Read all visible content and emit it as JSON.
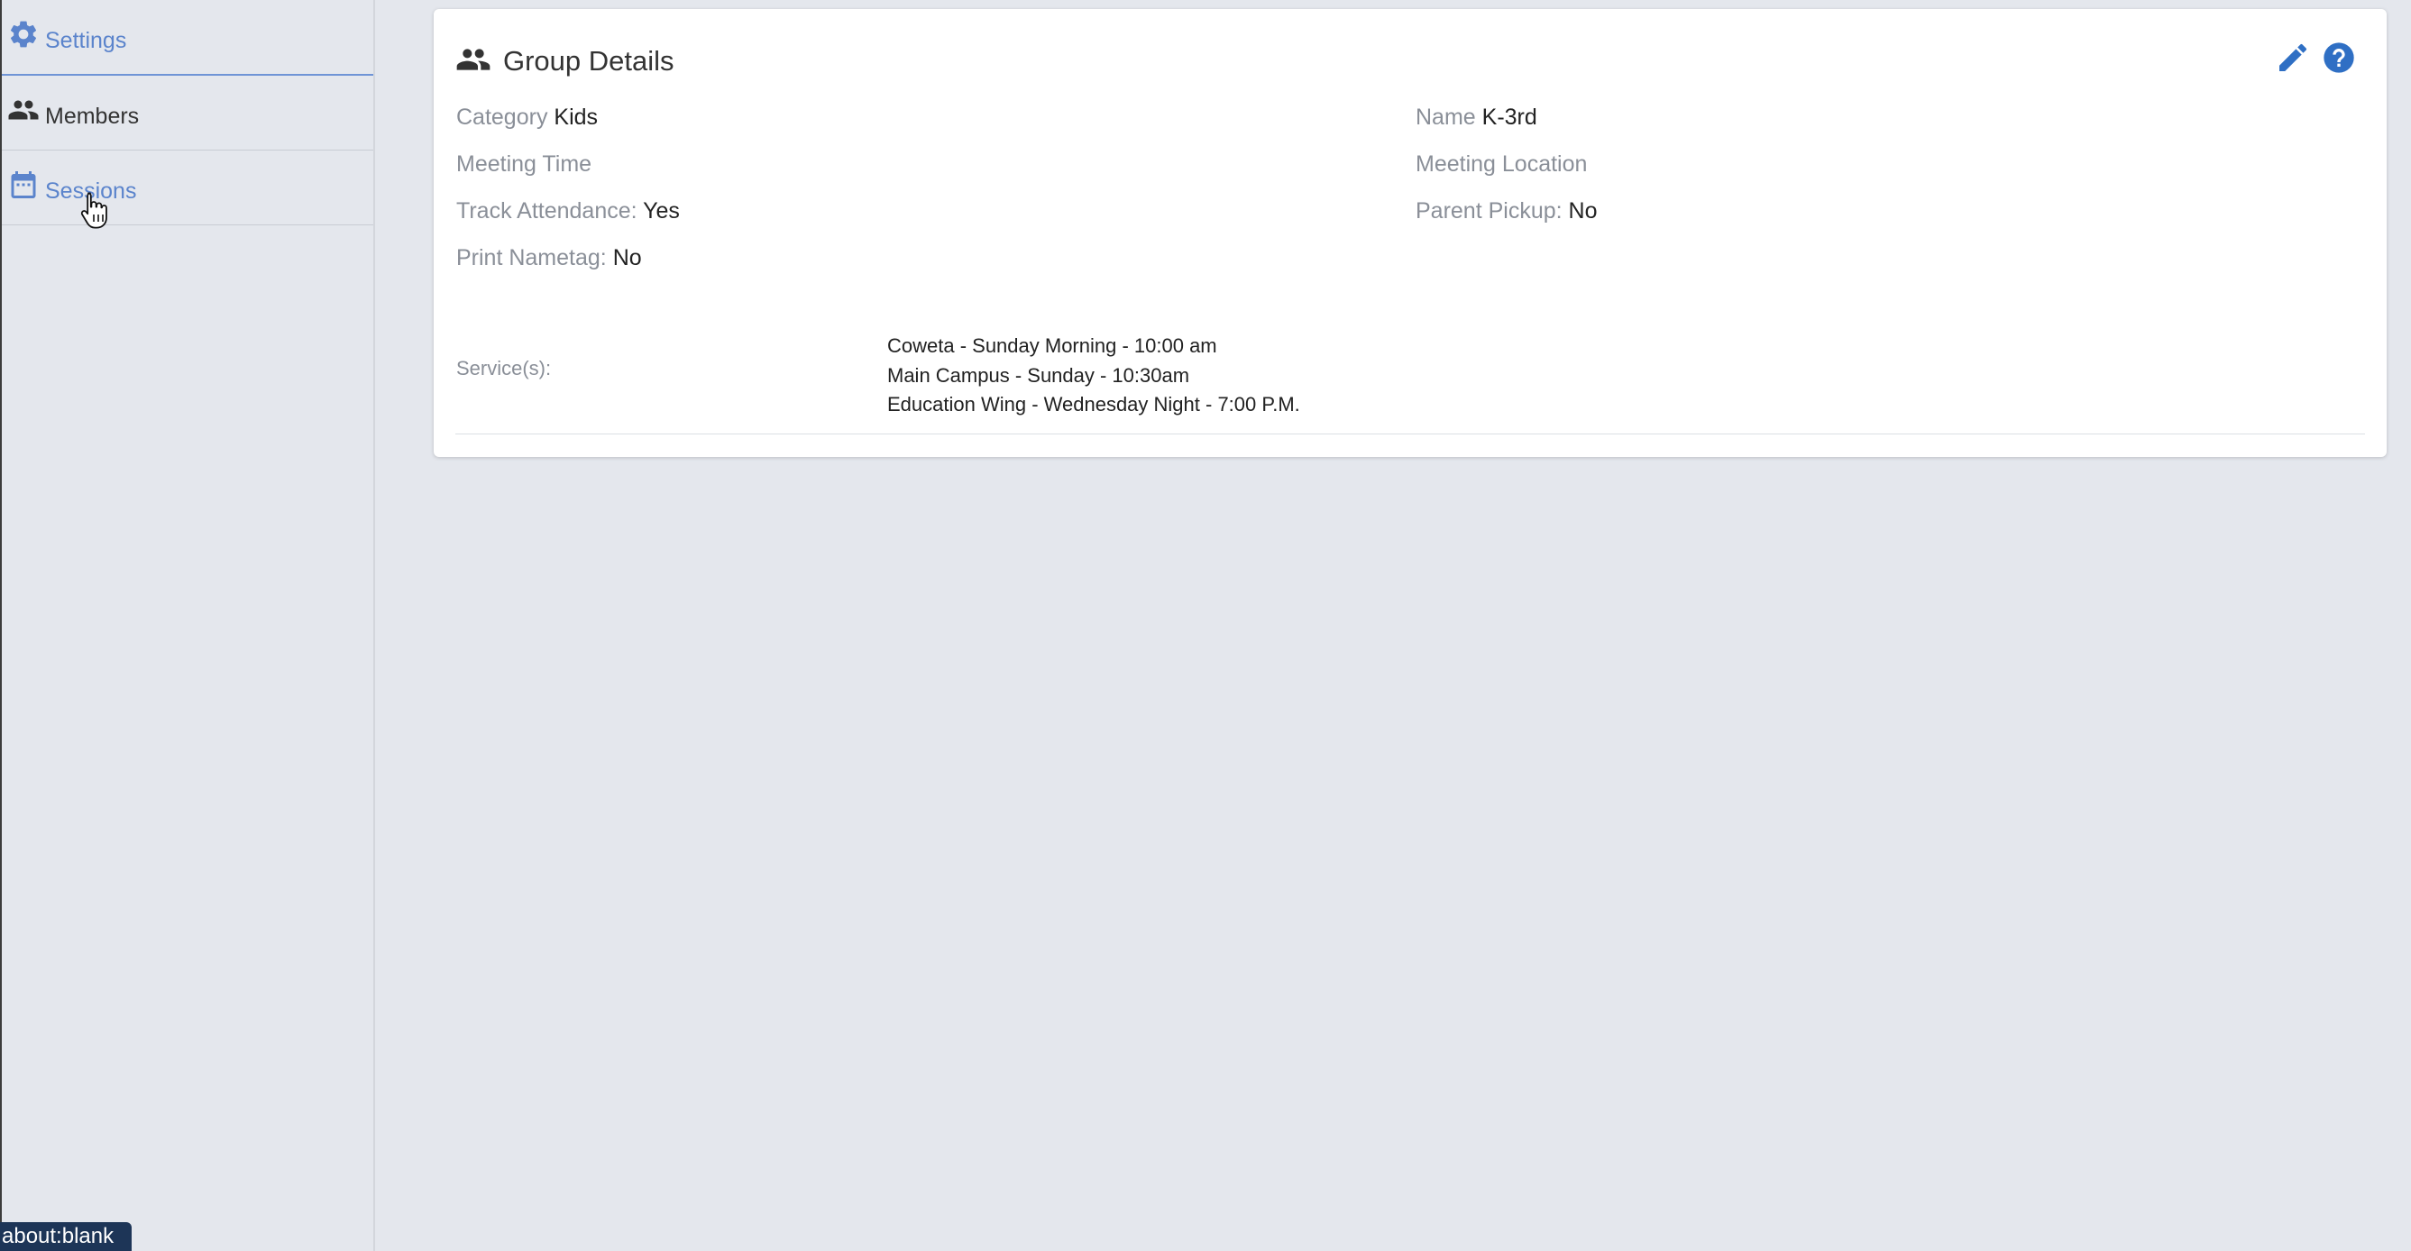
{
  "sidebar": {
    "items": [
      {
        "label": "Settings",
        "icon": "gear-icon",
        "color": "#5b84cc"
      },
      {
        "label": "Members",
        "icon": "people-icon",
        "color": "#333333"
      },
      {
        "label": "Sessions",
        "icon": "calendar-icon",
        "color": "#5b84cc"
      }
    ]
  },
  "card": {
    "title": "Group Details",
    "title_icon": "people-icon",
    "actions": {
      "edit_icon": "pencil-icon",
      "help_icon": "help-icon"
    },
    "fields": {
      "category": {
        "label": "Category",
        "value": "Kids"
      },
      "name": {
        "label": "Name",
        "value": "K-3rd"
      },
      "meeting_time": {
        "label": "Meeting Time",
        "value": ""
      },
      "meeting_location": {
        "label": "Meeting Location",
        "value": ""
      },
      "track_attendance": {
        "label": "Track Attendance:",
        "value": "Yes"
      },
      "parent_pickup": {
        "label": "Parent Pickup:",
        "value": "No"
      },
      "print_nametag": {
        "label": "Print Nametag:",
        "value": "No"
      }
    },
    "services": {
      "label": "Service(s):",
      "items": [
        "Coweta - Sunday Morning - 10:00 am",
        "Main Campus - Sunday - 10:30am",
        "Education Wing - Wednesday Night - 7:00 P.M."
      ]
    }
  },
  "statusbar": {
    "text": "about:blank"
  },
  "colors": {
    "accent": "#5b84cc",
    "icon_blue": "#2f6fc4",
    "background": "#e4e7ed",
    "statusbar_bg": "#1d3557"
  }
}
